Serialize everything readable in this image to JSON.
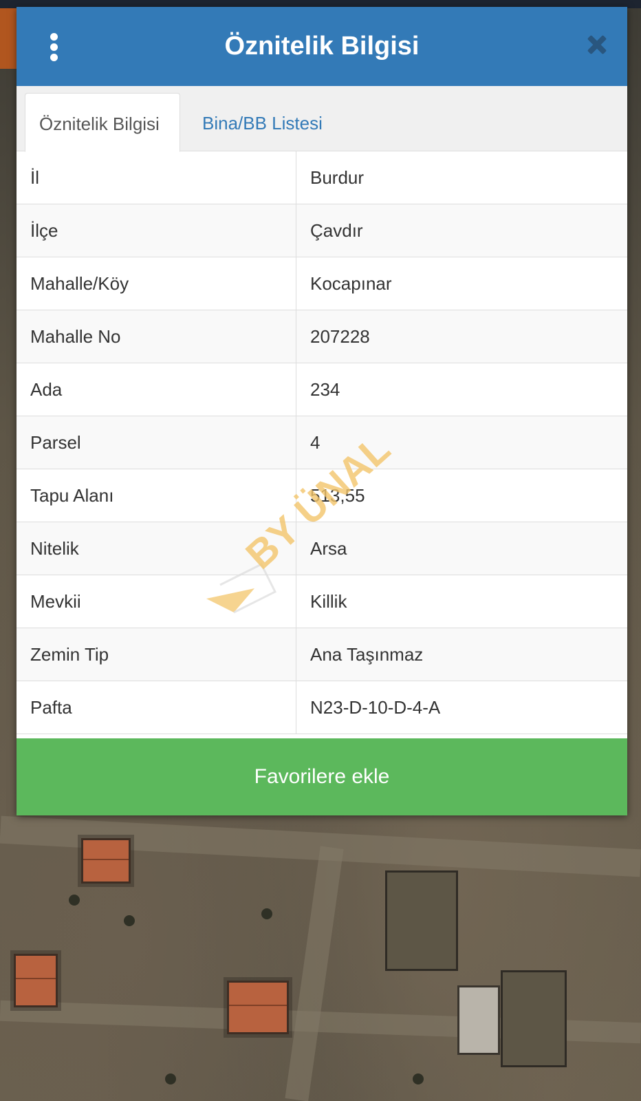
{
  "header": {
    "title": "Öznitelik Bilgisi"
  },
  "tabs": [
    {
      "label": "Öznitelik Bilgisi",
      "active": true
    },
    {
      "label": "Bina/BB Listesi",
      "active": false
    }
  ],
  "attributes": [
    {
      "key": "İl",
      "value": "Burdur"
    },
    {
      "key": "İlçe",
      "value": "Çavdır"
    },
    {
      "key": "Mahalle/Köy",
      "value": "Kocapınar"
    },
    {
      "key": "Mahalle No",
      "value": "207228"
    },
    {
      "key": "Ada",
      "value": "234"
    },
    {
      "key": "Parsel",
      "value": "4"
    },
    {
      "key": "Tapu Alanı",
      "value": "513,55"
    },
    {
      "key": "Nitelik",
      "value": "Arsa"
    },
    {
      "key": "Mevkii",
      "value": "Killik"
    },
    {
      "key": "Zemin Tip",
      "value": "Ana Taşınmaz"
    },
    {
      "key": "Pafta",
      "value": "N23-D-10-D-4-A"
    }
  ],
  "footer": {
    "favorite_label": "Favorilere ekle"
  },
  "watermark": {
    "text": "BY ÜNAL"
  },
  "colors": {
    "header": "#337ab7",
    "favorite_button": "#5cb85c",
    "tab_link": "#337ab7"
  }
}
